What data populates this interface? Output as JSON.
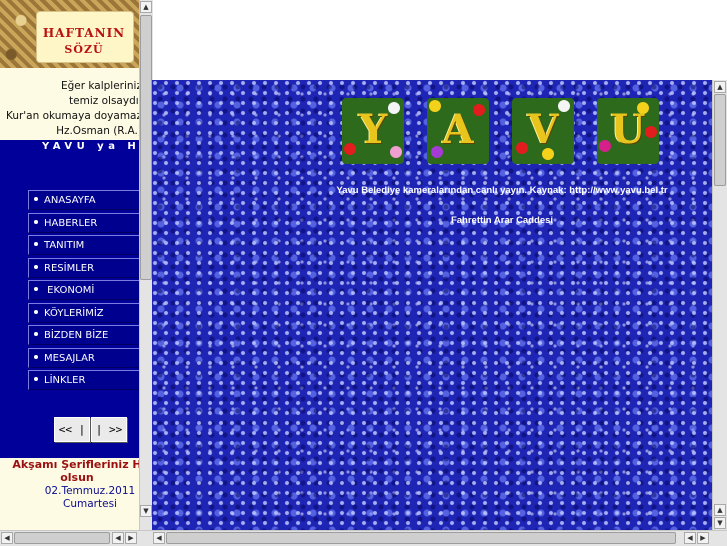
{
  "left_frame": {
    "banner": {
      "title_line1": "HAFTANIN",
      "title_line2": "SÖZÜ"
    },
    "quote": {
      "line1": "Eğer kalpleriniz",
      "line2": "temiz olsaydı,",
      "line3": "Kur'an okumaya doyamaz",
      "line4": "Hz.Osman (R.A.)"
    },
    "marquee": "YAVU ya H",
    "menu": [
      {
        "label": "ANASAYFA"
      },
      {
        "label": "HABERLER"
      },
      {
        "label": "TANITIM"
      },
      {
        "label": "RESİMLER"
      },
      {
        "label": " EKONOMİ"
      },
      {
        "label": "KÖYLERİMİZ"
      },
      {
        "label": "BİZDEN BİZE"
      },
      {
        "label": "MESAJLAR"
      },
      {
        "label": "LİNKLER"
      }
    ],
    "nav": {
      "prev": "<< |",
      "next": "| >>"
    },
    "greeting": {
      "line1": "Akşamı Şerifleriniz H",
      "line2": "olsun"
    },
    "date": {
      "line1": "02.Temmuz.2011",
      "line2": "Cumartesi"
    }
  },
  "right_frame": {
    "logo_letters": [
      "Y",
      "A",
      "V",
      "U"
    ],
    "caption": "Yavu Belediye kameralarından canlı yayın. Kaynak: http://www.yavu.bel.tr",
    "street": "Fahrettin Arar Caddesi"
  },
  "scrollbar_glyphs": {
    "up": "▲",
    "down": "▼",
    "left": "◀",
    "right": "▶"
  },
  "colors": {
    "menu_blue": "#01019a",
    "quote_bg": "#fdfbe4",
    "greeting_red": "#9a1010",
    "water_blue": "#1e24b4",
    "logo_gold": "#e8c51c"
  }
}
